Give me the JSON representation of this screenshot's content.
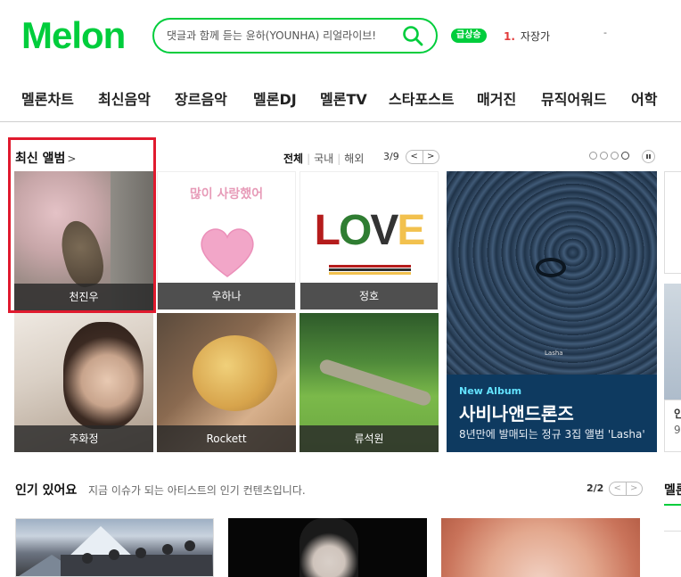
{
  "header": {
    "logo_text": "Melon",
    "search_placeholder": "댓글과 함께 듣는 윤하(YOUNHA) 리얼라이브!",
    "rising_badge": "급상승",
    "trend_rank": "1.",
    "trend_keyword": "자장가",
    "dash": "-"
  },
  "nav": {
    "items": [
      "멜론차트",
      "최신음악",
      "장르음악",
      "멜론DJ",
      "멜론TV",
      "스타포스트",
      "매거진",
      "뮤직어워드",
      "어학"
    ]
  },
  "latest_albums": {
    "title": "최신 앨범",
    "title_chevron": ">",
    "filters": [
      "전체",
      "국내",
      "해외"
    ],
    "page": "3/9",
    "prev": "<",
    "next": ">",
    "albums": [
      {
        "artist": "천진우"
      },
      {
        "artist": "우하나",
        "cover_text": "많이 사랑했어"
      },
      {
        "artist": "정호",
        "cover_text": "LOVE"
      },
      {
        "artist": "추화정"
      },
      {
        "artist": "Rockett"
      },
      {
        "artist": "류석원"
      }
    ],
    "feature": {
      "label": "New Album",
      "title": "사비나앤드론즈",
      "desc": "8년만에 발매되는 정규 3집 앨범 'Lasha'",
      "cover_text": "Lasha"
    },
    "peek_texts": [
      "인",
      "9"
    ]
  },
  "popular": {
    "title": "인기 있어요",
    "desc": "지금 이슈가 되는 아티스트의 인기 컨텐츠입니다.",
    "page": "2/2",
    "prev": "<",
    "next": ">",
    "side_title": "멜론"
  },
  "colors": {
    "brand": "#00cd3c",
    "highlight": "#e01a2e",
    "rank": "#e23b3b"
  }
}
